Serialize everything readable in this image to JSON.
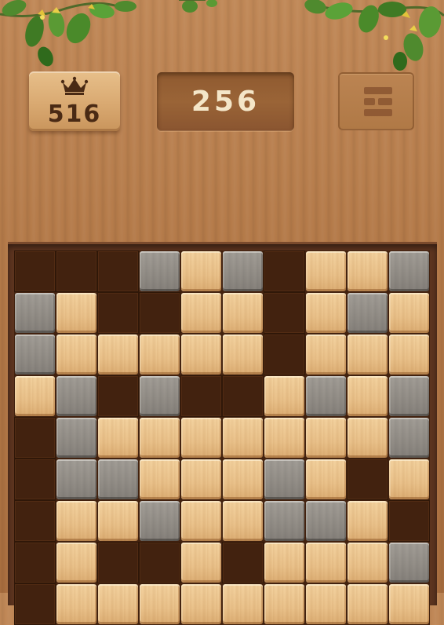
{
  "hud": {
    "best_score": "516",
    "current_score": "256",
    "best_icon": "crown-icon",
    "menu_icon": "menu-icon"
  },
  "colors": {
    "wood_tile": "#eac28b",
    "stone_tile": "#928d86",
    "empty_cell": "#42220f",
    "background": "#b47a49",
    "score_text": "#f4e6c8"
  },
  "board": {
    "columns": 10,
    "rows": 9,
    "legend": {
      "E": "empty",
      "W": "wood",
      "S": "stone"
    },
    "grid": [
      [
        "E",
        "E",
        "E",
        "S",
        "W",
        "S",
        "E",
        "W",
        "W",
        "S"
      ],
      [
        "S",
        "W",
        "E",
        "E",
        "W",
        "W",
        "E",
        "W",
        "S",
        "W"
      ],
      [
        "S",
        "W",
        "W",
        "W",
        "W",
        "W",
        "E",
        "W",
        "W",
        "W"
      ],
      [
        "W",
        "S",
        "E",
        "S",
        "E",
        "E",
        "W",
        "S",
        "W",
        "S"
      ],
      [
        "E",
        "S",
        "W",
        "W",
        "W",
        "W",
        "W",
        "W",
        "W",
        "S"
      ],
      [
        "E",
        "S",
        "S",
        "W",
        "W",
        "W",
        "S",
        "W",
        "E",
        "W"
      ],
      [
        "E",
        "W",
        "W",
        "S",
        "W",
        "W",
        "S",
        "S",
        "W",
        "E"
      ],
      [
        "E",
        "W",
        "E",
        "E",
        "W",
        "E",
        "W",
        "W",
        "W",
        "S"
      ],
      [
        "E",
        "W",
        "W",
        "W",
        "W",
        "W",
        "W",
        "W",
        "W",
        "W"
      ]
    ]
  }
}
